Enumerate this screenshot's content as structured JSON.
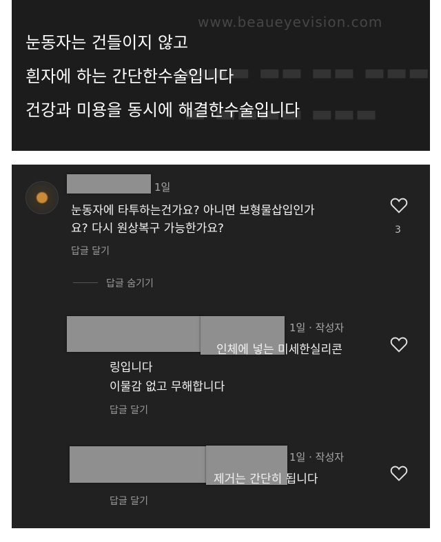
{
  "video": {
    "watermark": "www.beaueyevision.com",
    "subtitles": [
      "눈동자는 건들이지 않고",
      "흰자에 하는 간단한수술입니다",
      "건강과 미용을 동시에 해결한수술입니다"
    ]
  },
  "comments": {
    "main": {
      "time": "1일",
      "text_lines": [
        "눈동자에 타투하는건가요? 아니면 보형물삽입인가",
        "요? 다시 원상복구 가능한가요?"
      ],
      "reply_label": "답글 달기",
      "like_count": "3"
    },
    "hide_replies_label": "답글 숨기기",
    "reply1": {
      "time": "1일 · 작성자",
      "text_lines": [
        "인체에 넣는 미세한실리콘",
        "링입니다",
        "이물감 없고 무해합니다"
      ],
      "reply_label": "답글 달기"
    },
    "reply2": {
      "time": "1일 · 작성자",
      "text_lines": [
        "제거는 간단히 됩니다"
      ],
      "reply_label": "답글 달기"
    }
  },
  "colors": {
    "panel_bg": "#212121",
    "text": "#f2f2f2",
    "muted": "#a8a8a8",
    "video_bg": "#1c1c1c"
  }
}
